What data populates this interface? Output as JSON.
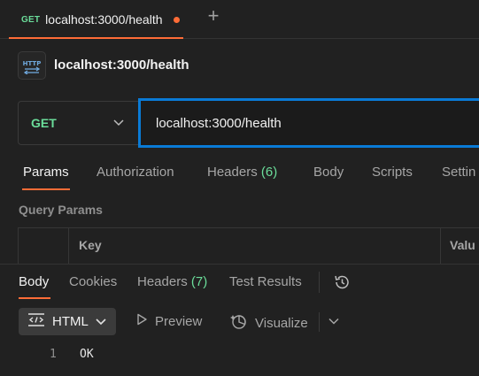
{
  "tab": {
    "method": "GET",
    "title": "localhost:3000/health"
  },
  "request": {
    "icon": "http-icon",
    "title": "localhost:3000/health",
    "method": "GET",
    "url": "localhost:3000/health"
  },
  "request_tabs": {
    "params": "Params",
    "authorization": "Authorization",
    "headers": "Headers",
    "headers_count": "(6)",
    "body": "Body",
    "scripts": "Scripts",
    "settings": "Settin"
  },
  "query_params": {
    "label": "Query Params",
    "col_key": "Key",
    "col_value": "Valu"
  },
  "response_tabs": {
    "body": "Body",
    "cookies": "Cookies",
    "headers": "Headers",
    "headers_count": "(7)",
    "test_results": "Test Results"
  },
  "response_toolbar": {
    "format": "HTML",
    "preview": "Preview",
    "visualize": "Visualize"
  },
  "response_body": {
    "line_number": "1",
    "line_text": "OK"
  },
  "colors": {
    "accent": "#ff6c37",
    "method_get": "#6bdd9a",
    "focus": "#0a7bd6"
  }
}
